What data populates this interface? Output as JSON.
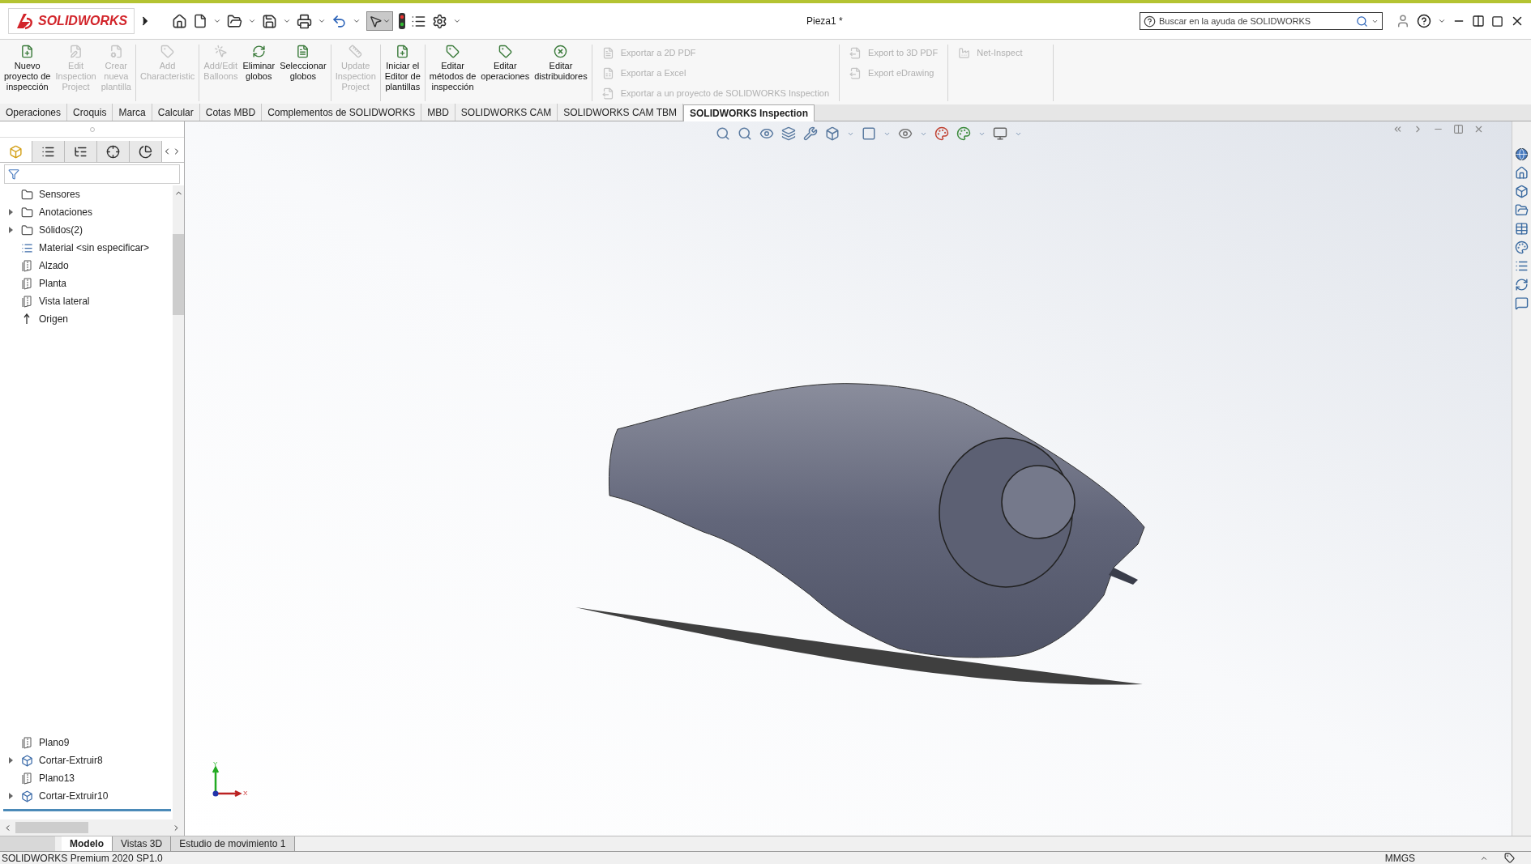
{
  "app": {
    "logo": "SOLIDWORKS",
    "document_title": "Pieza1 *"
  },
  "search": {
    "placeholder": "Buscar en la ayuda de SOLIDWORKS"
  },
  "ribbon": {
    "groups": [
      {
        "kind": "large",
        "buttons": [
          {
            "lines": [
              "Nuevo",
              "proyecto de",
              "inspección"
            ],
            "disabled": false
          },
          {
            "lines": [
              "Edit",
              "Inspection",
              "Project"
            ],
            "disabled": true
          },
          {
            "lines": [
              "Crear",
              "nueva",
              "plantilla"
            ],
            "disabled": true
          }
        ]
      },
      {
        "kind": "large",
        "buttons": [
          {
            "lines": [
              "Add",
              "Characteristic"
            ],
            "disabled": true
          }
        ]
      },
      {
        "kind": "large",
        "buttons": [
          {
            "lines": [
              "Add/Edit",
              "Balloons"
            ],
            "disabled": true
          },
          {
            "lines": [
              "Eliminar",
              "globos"
            ],
            "disabled": false
          },
          {
            "lines": [
              "Seleccionar",
              "globos"
            ],
            "disabled": false
          }
        ]
      },
      {
        "kind": "large",
        "buttons": [
          {
            "lines": [
              "Update",
              "Inspection",
              "Project"
            ],
            "disabled": true
          }
        ]
      },
      {
        "kind": "large",
        "buttons": [
          {
            "lines": [
              "Iniciar el",
              "Editor de",
              "plantillas"
            ],
            "disabled": false
          }
        ]
      },
      {
        "kind": "large",
        "buttons": [
          {
            "lines": [
              "Editar",
              "métodos de",
              "inspección"
            ],
            "disabled": false
          },
          {
            "lines": [
              "Editar",
              "operaciones"
            ],
            "disabled": false
          },
          {
            "lines": [
              "Editar",
              "distribuidores"
            ],
            "disabled": false
          }
        ]
      },
      {
        "kind": "small",
        "buttons": [
          {
            "lines": [
              "Exportar a 2D PDF"
            ],
            "disabled": true
          },
          {
            "lines": [
              "Exportar a Excel"
            ],
            "disabled": true
          },
          {
            "lines": [
              "Exportar a un proyecto de SOLIDWORKS Inspection"
            ],
            "disabled": true
          }
        ]
      },
      {
        "kind": "small",
        "buttons": [
          {
            "lines": [
              "Export to 3D PDF"
            ],
            "disabled": true
          },
          {
            "lines": [
              "Export eDrawing"
            ],
            "disabled": true
          }
        ]
      },
      {
        "kind": "small",
        "buttons": [
          {
            "lines": [
              "Net-Inspect"
            ],
            "disabled": true
          }
        ]
      }
    ]
  },
  "command_tabs": [
    {
      "label": "Operaciones",
      "selected": false
    },
    {
      "label": "Croquis",
      "selected": false
    },
    {
      "label": "Marca",
      "selected": false
    },
    {
      "label": "Calcular",
      "selected": false
    },
    {
      "label": "Cotas MBD",
      "selected": false
    },
    {
      "label": "Complementos de SOLIDWORKS",
      "selected": false
    },
    {
      "label": "MBD",
      "selected": false
    },
    {
      "label": "SOLIDWORKS CAM",
      "selected": false
    },
    {
      "label": "SOLIDWORKS CAM TBM",
      "selected": false
    },
    {
      "label": "SOLIDWORKS Inspection",
      "selected": true
    }
  ],
  "manager_tabs": [
    {
      "selected": true
    },
    {
      "selected": false
    },
    {
      "selected": false
    },
    {
      "selected": false
    },
    {
      "selected": false
    }
  ],
  "tree": {
    "top_items": [
      {
        "label": "Sensores",
        "kind": "sensors",
        "expander": false
      },
      {
        "label": "Anotaciones",
        "kind": "annotations",
        "expander": true
      },
      {
        "label": "Sólidos(2)",
        "kind": "solids",
        "expander": true
      },
      {
        "label": "Material <sin especificar>",
        "kind": "material",
        "expander": false
      },
      {
        "label": "Alzado",
        "kind": "plane",
        "expander": false
      },
      {
        "label": "Planta",
        "kind": "plane",
        "expander": false
      },
      {
        "label": "Vista lateral",
        "kind": "plane",
        "expander": false
      },
      {
        "label": "Origen",
        "kind": "origin",
        "expander": false
      }
    ],
    "bottom_items": [
      {
        "label": "Plano9",
        "kind": "plane",
        "expander": false
      },
      {
        "label": "Cortar-Extruir8",
        "kind": "cut",
        "expander": true
      },
      {
        "label": "Plano13",
        "kind": "plane",
        "expander": false
      },
      {
        "label": "Cortar-Extruir10",
        "kind": "cut",
        "expander": true
      }
    ]
  },
  "triad": {
    "x_label": "X",
    "y_label": "Y"
  },
  "bottom_tabs": [
    {
      "label": "Modelo",
      "selected": true
    },
    {
      "label": "Vistas 3D",
      "selected": false
    },
    {
      "label": "Estudio de movimiento 1",
      "selected": false
    }
  ],
  "status_bar": {
    "product": "SOLIDWORKS Premium 2020 SP1.0",
    "units": "MMGS"
  }
}
